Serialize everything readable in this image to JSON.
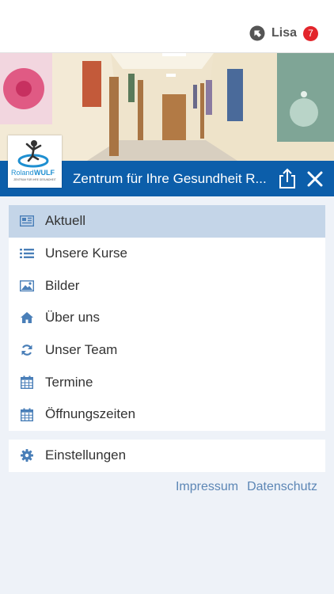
{
  "user": {
    "name": "Lisa",
    "badge_count": "7",
    "icon": "user-status-icon"
  },
  "header": {
    "title": "Zentrum für Ihre Gesundheit R...",
    "share_icon": "share-icon",
    "close_icon": "close-icon"
  },
  "logo": {
    "brand_first": "Roland",
    "brand_second": "WULF",
    "tagline": "ZENTRUM FÜR IHRE GESUNDHEIT"
  },
  "menu": {
    "items": [
      {
        "label": "Aktuell",
        "icon": "newspaper-icon",
        "active": true
      },
      {
        "label": "Unsere Kurse",
        "icon": "list-icon"
      },
      {
        "label": "Bilder",
        "icon": "image-icon"
      },
      {
        "label": "Über uns",
        "icon": "home-icon"
      },
      {
        "label": "Unser Team",
        "icon": "refresh-icon"
      },
      {
        "label": "Termine",
        "icon": "calendar-icon"
      },
      {
        "label": "Öffnungszeiten",
        "icon": "calendar-icon"
      }
    ]
  },
  "settings": {
    "label": "Einstellungen",
    "icon": "gear-icon"
  },
  "footer": {
    "impressum": "Impressum",
    "datenschutz": "Datenschutz"
  },
  "colors": {
    "accent": "#0c5eaa",
    "active_bg": "#c4d5e8",
    "badge": "#e3252b",
    "icon": "#4a7fb8",
    "link": "#5c86b5"
  }
}
